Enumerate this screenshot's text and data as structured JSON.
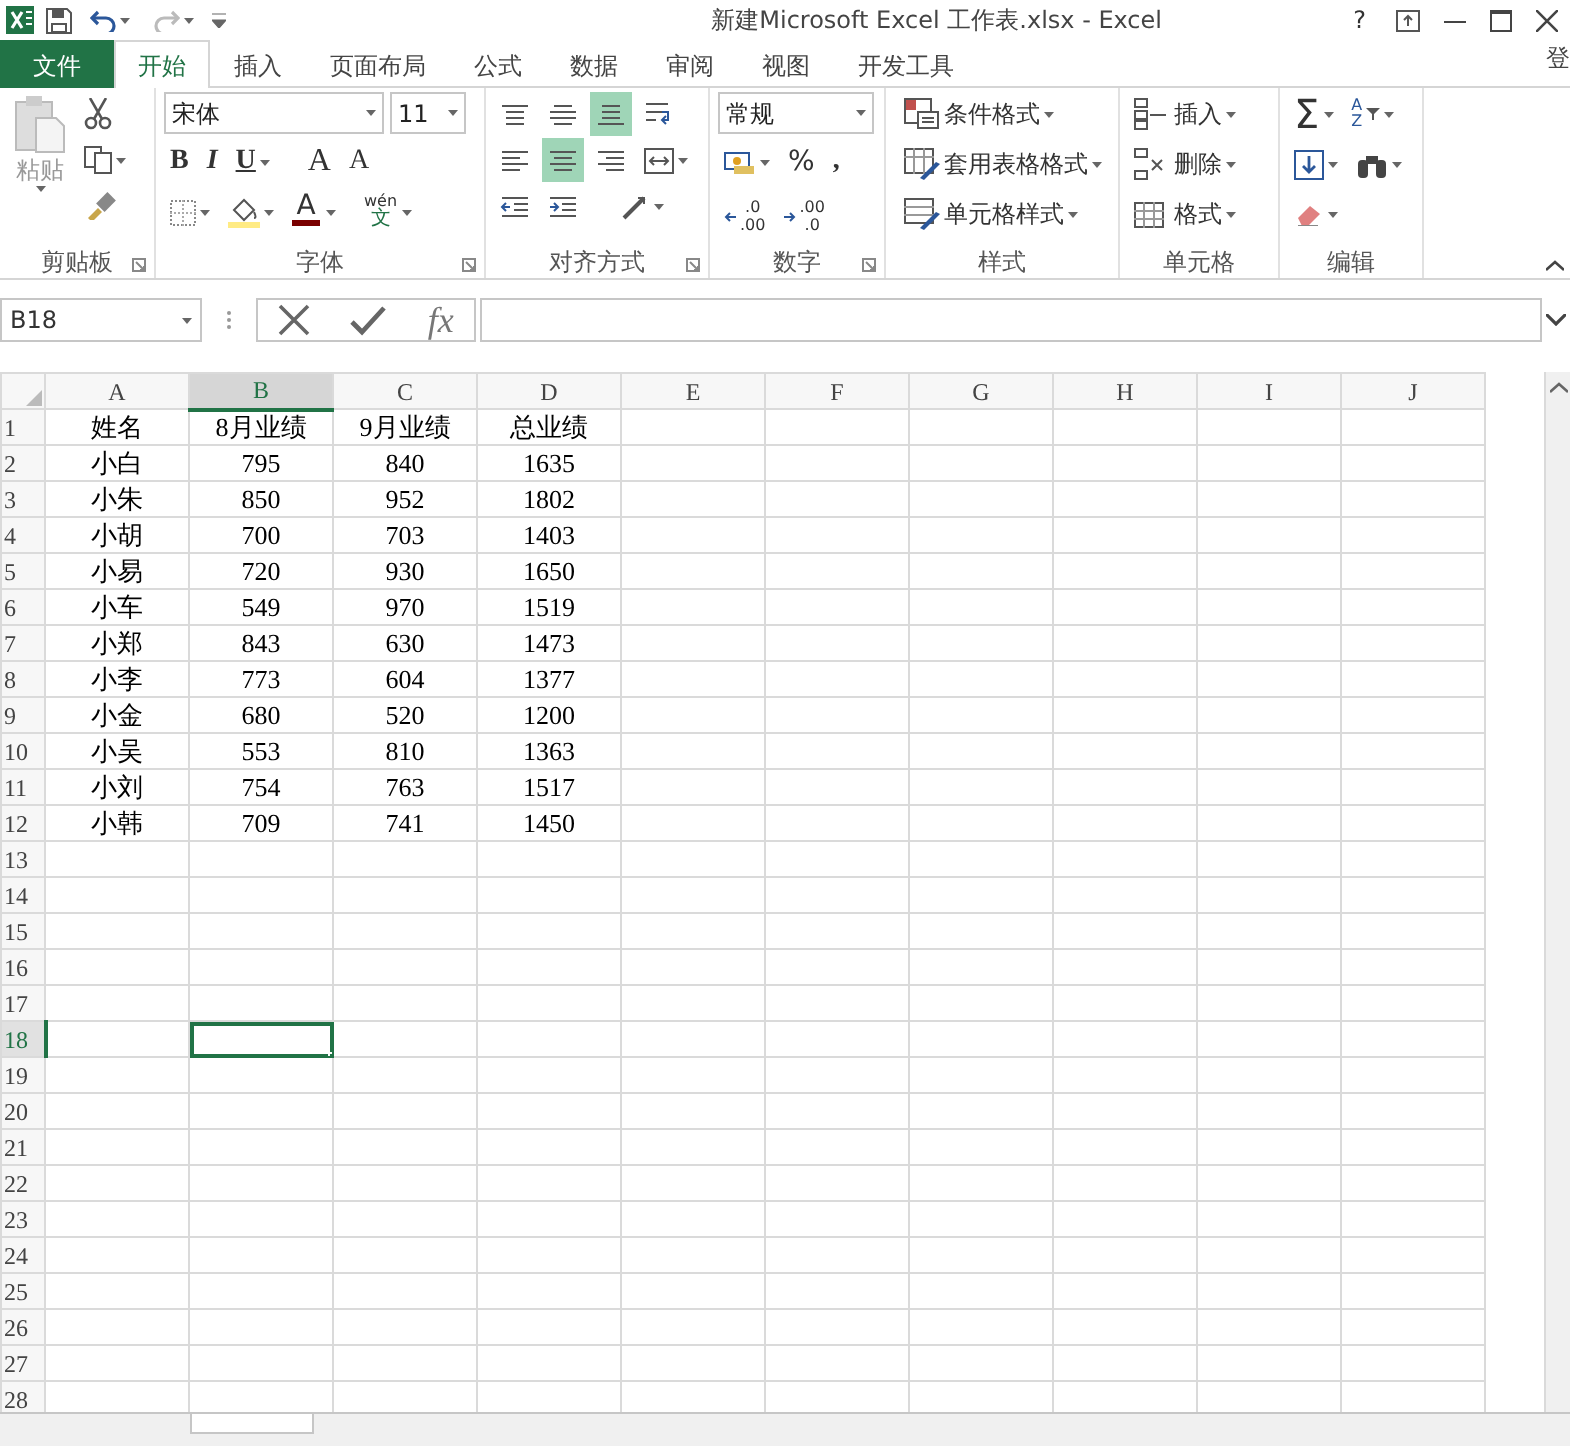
{
  "title_bar": {
    "title": "新建Microsoft Excel 工作表.xlsx - Excel",
    "help": "?"
  },
  "tabs": [
    {
      "label": "文件",
      "kind": "file",
      "selected": false
    },
    {
      "label": "开始",
      "kind": "tab",
      "selected": true
    },
    {
      "label": "插入",
      "kind": "tab",
      "selected": false
    },
    {
      "label": "页面布局",
      "kind": "tab",
      "selected": false
    },
    {
      "label": "公式",
      "kind": "tab",
      "selected": false
    },
    {
      "label": "数据",
      "kind": "tab",
      "selected": false
    },
    {
      "label": "审阅",
      "kind": "tab",
      "selected": false
    },
    {
      "label": "视图",
      "kind": "tab",
      "selected": false
    },
    {
      "label": "开发工具",
      "kind": "tab",
      "selected": false
    }
  ],
  "account": "登",
  "ribbon": {
    "clipboard": {
      "label": "剪贴板",
      "paste": "粘贴"
    },
    "font": {
      "label": "字体",
      "font_name": "宋体",
      "font_size": "11",
      "bold": "B",
      "italic": "I",
      "underline": "U",
      "grow": "A",
      "shrink": "A",
      "font_color": "A",
      "phonetic_top": "wén",
      "phonetic_bottom": "文"
    },
    "alignment": {
      "label": "对齐方式",
      "buttons": [
        {
          "selected": false
        },
        {
          "selected": false
        },
        {
          "selected": true
        },
        {
          "selected": false
        },
        {
          "selected": false
        },
        {
          "selected": true
        },
        {
          "selected": false
        },
        {
          "selected": false
        },
        {
          "selected": false
        },
        {
          "selected": false
        },
        {
          "selected": false
        }
      ]
    },
    "number": {
      "label": "数字",
      "format": "常规",
      "percent": "%",
      "comma": ",",
      "increase_decimal": [
        ".0",
        ".00"
      ],
      "decrease_decimal": [
        ".00",
        ".0"
      ]
    },
    "styles": {
      "label": "样式",
      "commands": [
        "条件格式",
        "套用表格格式",
        "单元格样式"
      ]
    },
    "cells": {
      "label": "单元格",
      "commands": [
        "插入",
        "删除",
        "格式"
      ]
    },
    "editing": {
      "label": "编辑",
      "autosum": "Σ",
      "sort": [
        "A",
        "Z"
      ]
    }
  },
  "formula_bar": {
    "name_box": "B18",
    "function": "fx"
  },
  "sheet": {
    "columns": [
      {
        "label": "A",
        "selected": false
      },
      {
        "label": "B",
        "selected": true
      },
      {
        "label": "C",
        "selected": false
      },
      {
        "label": "D",
        "selected": false
      },
      {
        "label": "E",
        "selected": false
      },
      {
        "label": "F",
        "selected": false
      },
      {
        "label": "G",
        "selected": false
      },
      {
        "label": "H",
        "selected": false
      },
      {
        "label": "I",
        "selected": false
      },
      {
        "label": "J",
        "selected": false
      }
    ],
    "rows": [
      {
        "label": "1",
        "selected": false,
        "cells": [
          "姓名",
          "8月业绩",
          "9月业绩",
          "总业绩"
        ]
      },
      {
        "label": "2",
        "selected": false,
        "cells": [
          "小白",
          "795",
          "840",
          "1635"
        ]
      },
      {
        "label": "3",
        "selected": false,
        "cells": [
          "小朱",
          "850",
          "952",
          "1802"
        ]
      },
      {
        "label": "4",
        "selected": false,
        "cells": [
          "小胡",
          "700",
          "703",
          "1403"
        ]
      },
      {
        "label": "5",
        "selected": false,
        "cells": [
          "小易",
          "720",
          "930",
          "1650"
        ]
      },
      {
        "label": "6",
        "selected": false,
        "cells": [
          "小车",
          "549",
          "970",
          "1519"
        ]
      },
      {
        "label": "7",
        "selected": false,
        "cells": [
          "小郑",
          "843",
          "630",
          "1473"
        ]
      },
      {
        "label": "8",
        "selected": false,
        "cells": [
          "小李",
          "773",
          "604",
          "1377"
        ]
      },
      {
        "label": "9",
        "selected": false,
        "cells": [
          "小金",
          "680",
          "520",
          "1200"
        ]
      },
      {
        "label": "10",
        "selected": false,
        "cells": [
          "小吴",
          "553",
          "810",
          "1363"
        ]
      },
      {
        "label": "11",
        "selected": false,
        "cells": [
          "小刘",
          "754",
          "763",
          "1517"
        ]
      },
      {
        "label": "12",
        "selected": false,
        "cells": [
          "小韩",
          "709",
          "741",
          "1450"
        ]
      },
      {
        "label": "13",
        "selected": false
      },
      {
        "label": "14",
        "selected": false
      },
      {
        "label": "15",
        "selected": false
      },
      {
        "label": "16",
        "selected": false
      },
      {
        "label": "17",
        "selected": false
      },
      {
        "label": "18",
        "selected": true
      },
      {
        "label": "19",
        "selected": false
      },
      {
        "label": "20",
        "selected": false
      },
      {
        "label": "21",
        "selected": false
      },
      {
        "label": "22",
        "selected": false
      },
      {
        "label": "23",
        "selected": false
      },
      {
        "label": "24",
        "selected": false
      },
      {
        "label": "25",
        "selected": false
      },
      {
        "label": "26",
        "selected": false
      },
      {
        "label": "27",
        "selected": false
      },
      {
        "label": "28",
        "selected": false
      }
    ]
  }
}
